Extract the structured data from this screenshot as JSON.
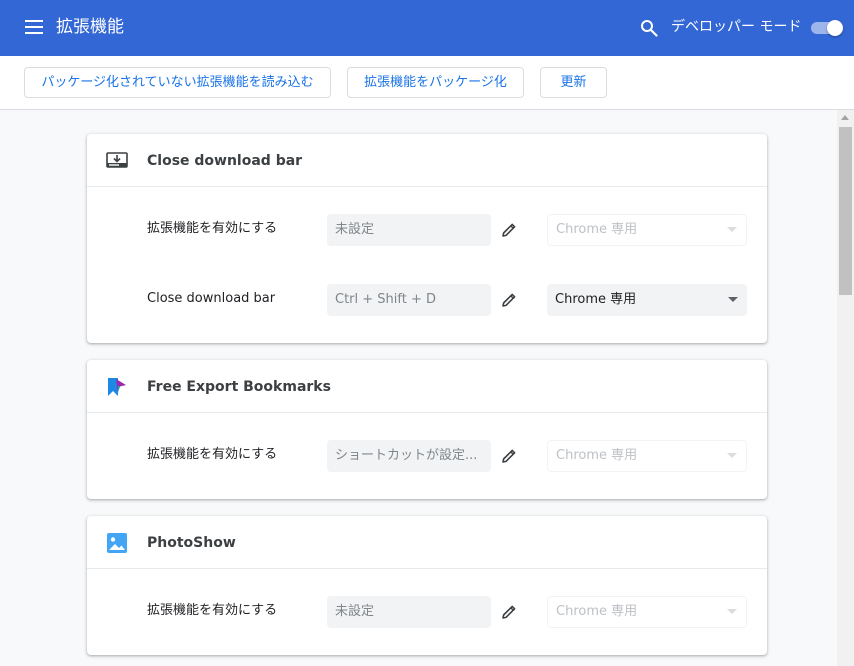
{
  "header": {
    "title": "拡張機能",
    "dev_mode_label": "デベロッパー モード",
    "dev_mode_enabled": true,
    "color": "#3367d6"
  },
  "toolbar": {
    "load_unpacked": "パッケージ化されていない拡張機能を読み込む",
    "pack_extension": "拡張機能をパッケージ化",
    "update": "更新"
  },
  "extensions": [
    {
      "name": "Close download bar",
      "icon": "download-bar-icon",
      "shortcuts": [
        {
          "label": "拡張機能を有効にする",
          "value": "未設定",
          "scope": "Chrome 専用",
          "enabled": false
        },
        {
          "label": "Close download bar",
          "value": "Ctrl + Shift + D",
          "scope": "Chrome 専用",
          "enabled": true
        }
      ]
    },
    {
      "name": "Free Export Bookmarks",
      "icon": "bookmark-export-icon",
      "shortcuts": [
        {
          "label": "拡張機能を有効にする",
          "value": "ショートカットが設定...",
          "scope": "Chrome 専用",
          "enabled": false
        }
      ]
    },
    {
      "name": "PhotoShow",
      "icon": "photo-icon",
      "shortcuts": [
        {
          "label": "拡張機能を有効にする",
          "value": "未設定",
          "scope": "Chrome 専用",
          "enabled": false
        }
      ]
    }
  ]
}
